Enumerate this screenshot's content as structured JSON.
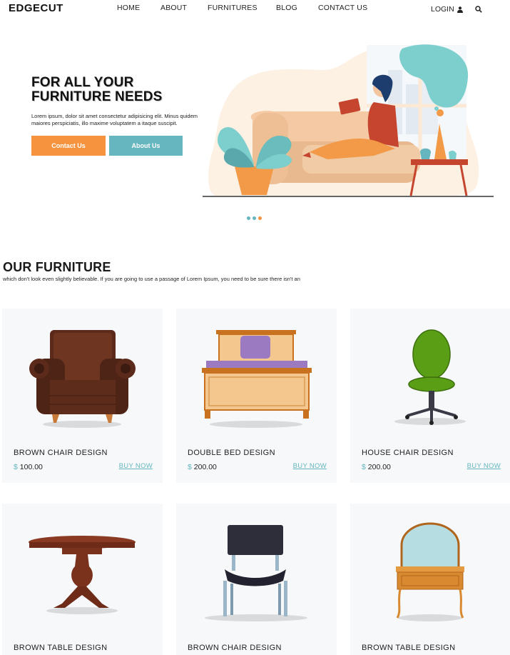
{
  "header": {
    "brand": "EDGECUT",
    "nav": [
      "HOME",
      "ABOUT",
      "FURNITURES",
      "BLOG",
      "CONTACT US"
    ],
    "login": "LOGIN"
  },
  "hero": {
    "title_line1": "FOR ALL YOUR",
    "title_line2": "FURNITURE NEEDS",
    "description": "Lorem ipsum, dolor sit amet consectetur adipisicing elit. Minus quidem maiores perspiciatis, illo maxime voluptatem a itaque suscipit.",
    "contact_button": "Contact Us",
    "about_button": "About Us"
  },
  "colors": {
    "accent_orange": "#f6933f",
    "accent_teal": "#66b6bf"
  },
  "section": {
    "title": "OUR FURNITURE",
    "subtitle": "which don't look even slightly believable. If you are going to use a passage of Lorem Ipsum, you need to be sure there isn't an"
  },
  "products": [
    {
      "name": "BROWN CHAIR DESIGN",
      "currency": "$",
      "price": "100.00",
      "buy": "BUY NOW",
      "icon": "armchair-icon"
    },
    {
      "name": "DOUBLE BED DESIGN",
      "currency": "$",
      "price": "200.00",
      "buy": "BUY NOW",
      "icon": "bed-icon"
    },
    {
      "name": "HOUSE CHAIR DESIGN",
      "currency": "$",
      "price": "200.00",
      "buy": "BUY NOW",
      "icon": "office-chair-icon"
    },
    {
      "name": "BROWN TABLE DESIGN",
      "icon": "round-table-icon"
    },
    {
      "name": "BROWN CHAIR DESIGN",
      "icon": "chair-icon"
    },
    {
      "name": "BROWN TABLE DESIGN",
      "icon": "dressing-table-icon"
    }
  ]
}
